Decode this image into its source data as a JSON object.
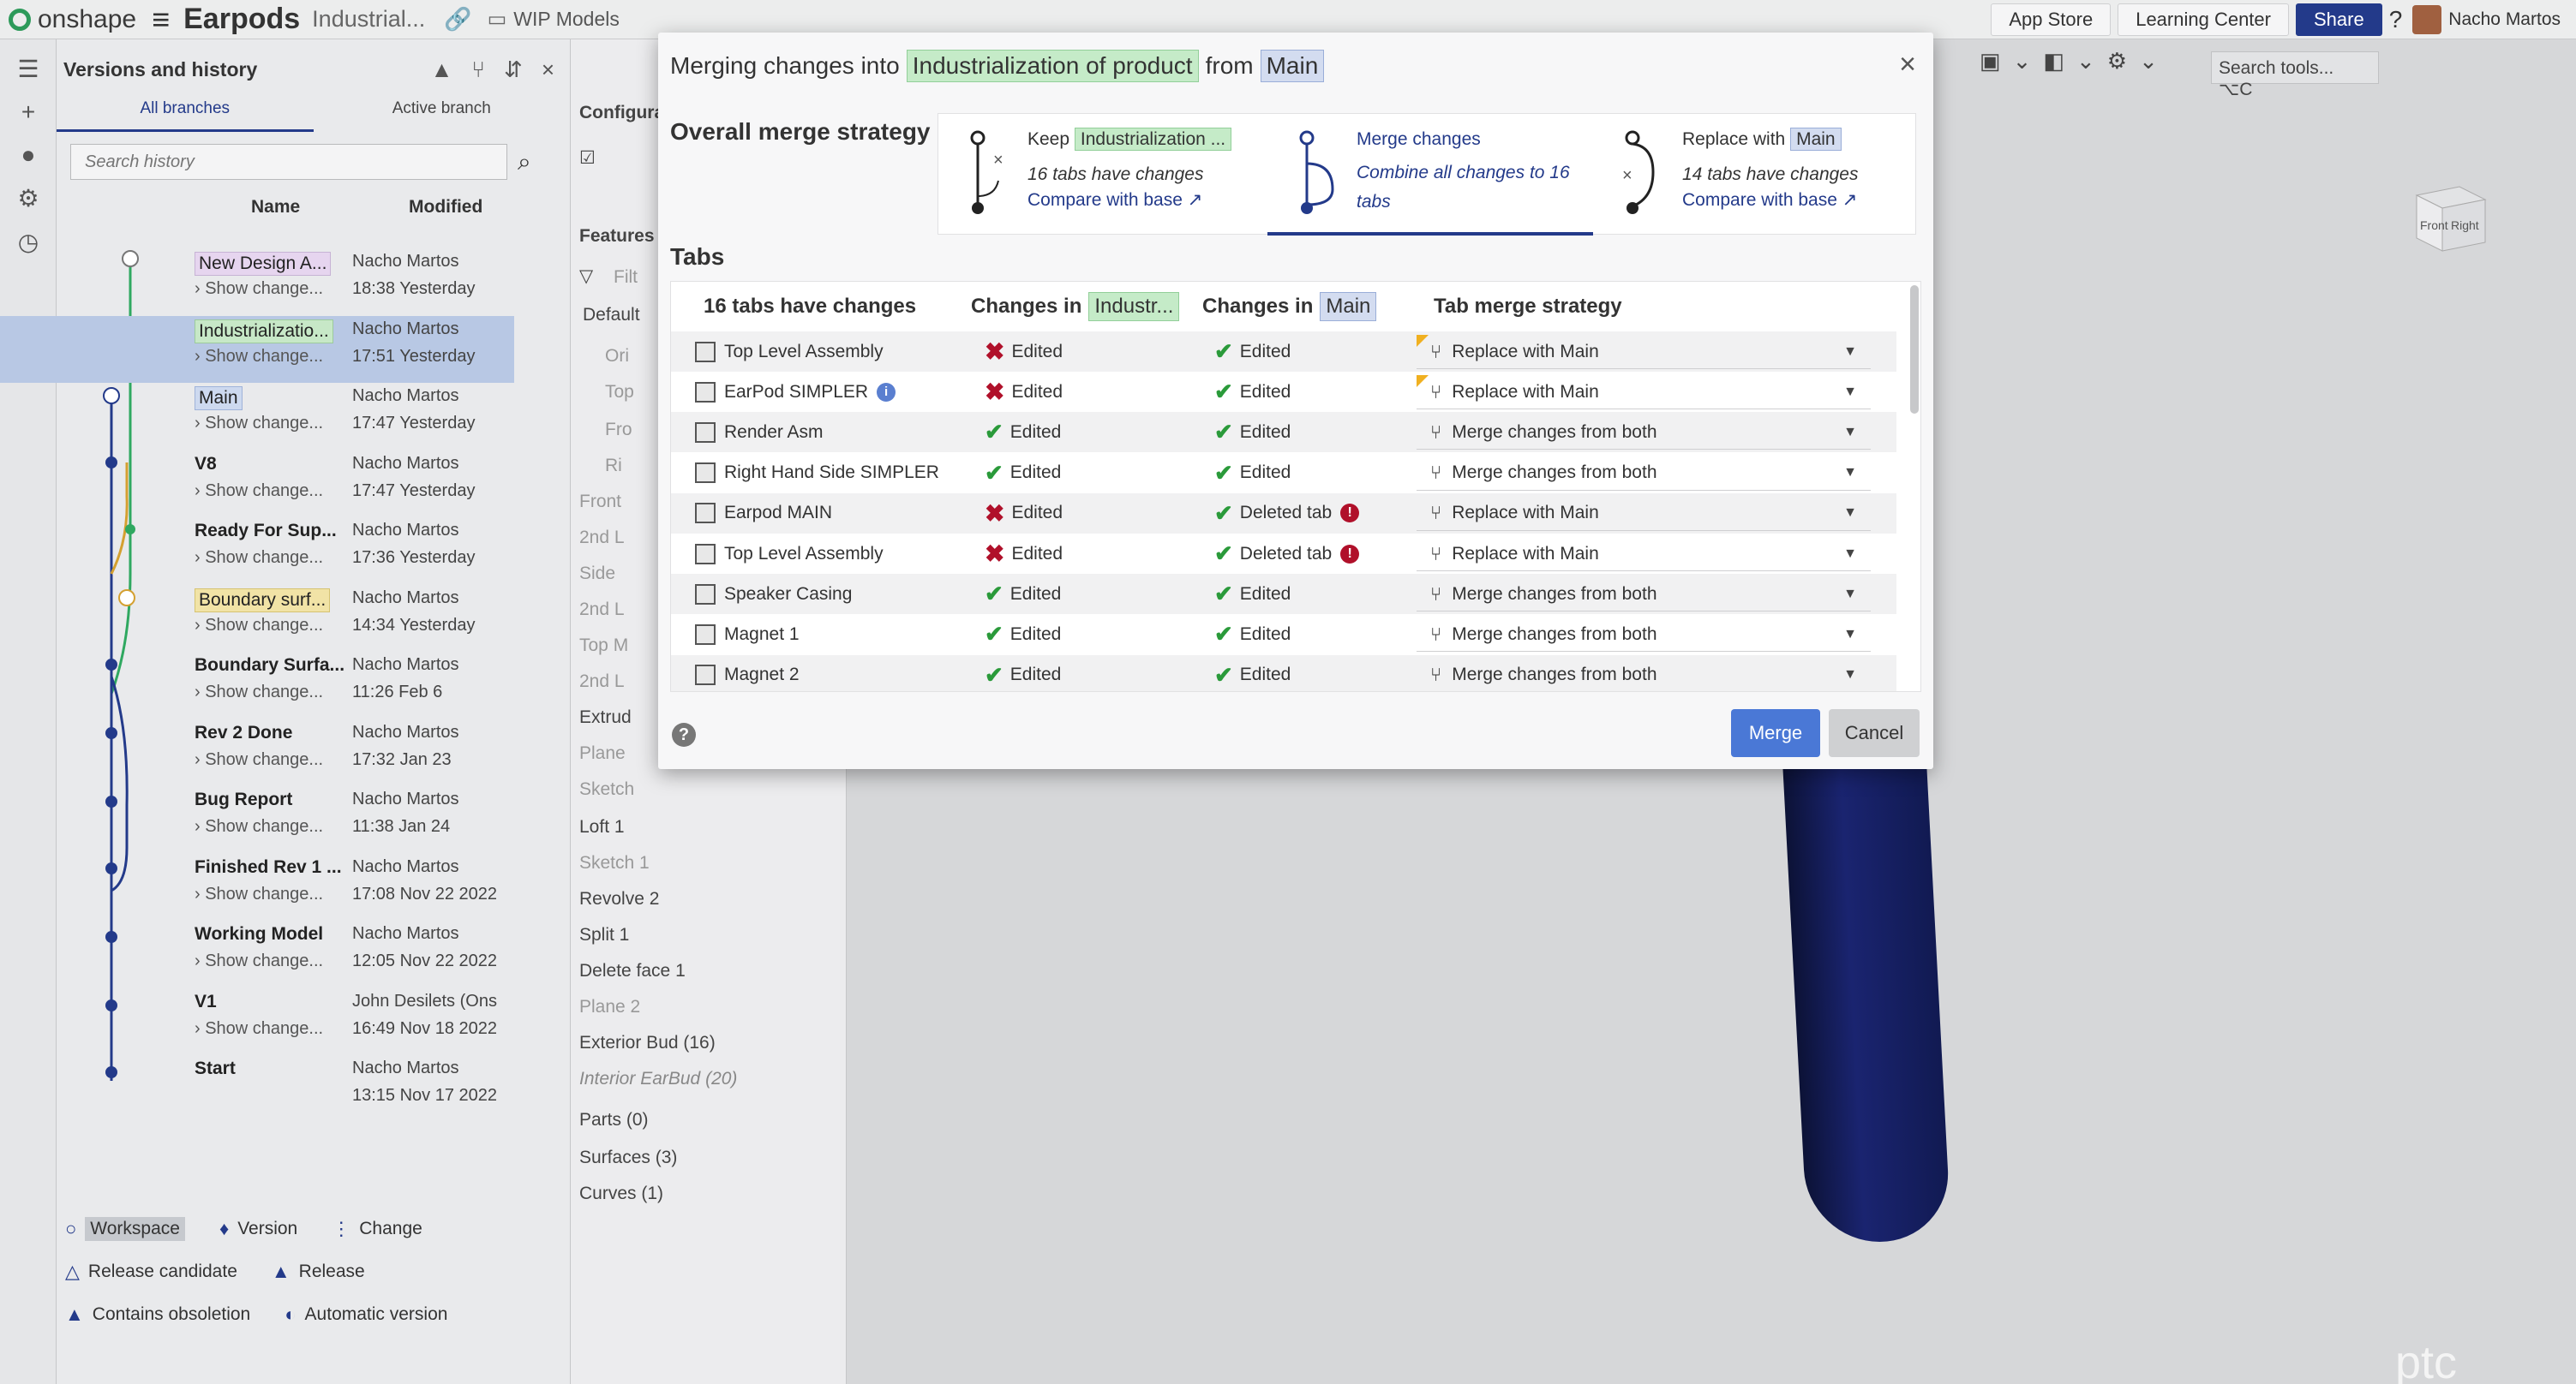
{
  "app": {
    "brand": "onshape",
    "doc_title": "Earpods",
    "doc_subtitle": "Industrial...",
    "folder": "WIP Models",
    "top_buttons": [
      "App Store",
      "Learning Center",
      "Share"
    ],
    "user": "Nacho Martos"
  },
  "versions_panel": {
    "title": "Versions and history",
    "tabs": [
      "All branches",
      "Active branch"
    ],
    "search_placeholder": "Search history",
    "col_name": "Name",
    "col_modified": "Modified",
    "rows": [
      {
        "name": "New Design A...",
        "sub": "Show change...",
        "who": "Nacho Martos",
        "when": "18:38 Yesterday",
        "style": "tag"
      },
      {
        "name": "Industrializatio...",
        "sub": "Show change...",
        "who": "Nacho Martos",
        "when": "17:51 Yesterday",
        "style": "tag green"
      },
      {
        "name": "Main",
        "sub": "Show change...",
        "who": "Nacho Martos",
        "when": "17:47 Yesterday",
        "style": "tag blue"
      },
      {
        "name": "V8",
        "sub": "Show change...",
        "who": "Nacho Martos",
        "when": "17:47 Yesterday",
        "style": ""
      },
      {
        "name": "Ready For Sup...",
        "sub": "Show change...",
        "who": "Nacho Martos",
        "when": "17:36 Yesterday",
        "style": ""
      },
      {
        "name": "Boundary surf...",
        "sub": "Show change...",
        "who": "Nacho Martos",
        "when": "14:34 Yesterday",
        "style": "tag yellow"
      },
      {
        "name": "Boundary Surfa...",
        "sub": "Show change...",
        "who": "Nacho Martos",
        "when": "11:26 Feb 6",
        "style": ""
      },
      {
        "name": "Rev 2 Done",
        "sub": "Show change...",
        "who": "Nacho Martos",
        "when": "17:32 Jan 23",
        "style": ""
      },
      {
        "name": "Bug Report",
        "sub": "Show change...",
        "who": "Nacho Martos",
        "when": "11:38 Jan 24",
        "style": ""
      },
      {
        "name": "Finished Rev 1 ...",
        "sub": "Show change...",
        "who": "Nacho Martos",
        "when": "17:08 Nov 22 2022",
        "style": ""
      },
      {
        "name": "Working Model",
        "sub": "Show change...",
        "who": "Nacho Martos",
        "when": "12:05 Nov 22 2022",
        "style": ""
      },
      {
        "name": "V1",
        "sub": "Show change...",
        "who": "John Desilets (Ons",
        "when": "16:49 Nov 18 2022",
        "style": ""
      },
      {
        "name": "Start",
        "sub": "",
        "who": "Nacho Martos",
        "when": "13:15 Nov 17 2022",
        "style": ""
      }
    ],
    "legend": {
      "workspace": "Workspace",
      "version": "Version",
      "change": "Change",
      "release_candidate": "Release candidate",
      "release": "Release",
      "contains_obsoletion": "Contains obsoletion",
      "automatic_version": "Automatic version"
    }
  },
  "features": {
    "header_config": "Configura",
    "header_features": "Features (",
    "filter_placeholder": "Filt",
    "items": [
      "Default",
      "Ori",
      "Top",
      "Fro",
      "Ri",
      "Front",
      "2nd L",
      "Side",
      "2nd L",
      "Top M",
      "2nd L",
      "Extrud",
      "Plane",
      "Sketch",
      "Loft 1",
      "Sketch 1",
      "Revolve 2",
      "Split 1",
      "Delete face 1",
      "Plane 2",
      "Exterior Bud (16)",
      "Interior EarBud (20)",
      "Parts (0)",
      "Surfaces (3)",
      "Curves (1)"
    ]
  },
  "viewport": {
    "search_tools": "Search tools...",
    "search_shortcut": "⌥C",
    "cube_front": "Front",
    "cube_right": "Right",
    "brand": "ptc"
  },
  "dialog": {
    "title_prefix": "Merging changes into",
    "title_target": "Industrialization of product",
    "title_mid": "from",
    "title_source": "Main",
    "strategy_label": "Overall merge strategy",
    "strategies": [
      {
        "title_prefix": "Keep",
        "title_tag": "Industrialization ...",
        "sub": "16 tabs have changes",
        "compare": "Compare with base ↗"
      },
      {
        "title_prefix": "Merge changes",
        "title_tag": "",
        "sub": "Combine all changes to 16 tabs",
        "compare": ""
      },
      {
        "title_prefix": "Replace with",
        "title_tag": "Main",
        "sub": "14 tabs have changes",
        "compare": "Compare with base ↗"
      }
    ],
    "tabs_label": "Tabs",
    "col_tabs": "16 tabs have changes",
    "col_changes_in": "Changes in",
    "col_target_tag": "Industr...",
    "col_source_tag": "Main",
    "col_strategy": "Tab merge strategy",
    "rows": [
      {
        "name": "Top Level Assembly",
        "info": false,
        "target": "Edited",
        "target_ok": false,
        "source": "Edited",
        "source_warn": false,
        "strategy": "Replace with Main",
        "flag": true
      },
      {
        "name": "EarPod SIMPLER",
        "info": true,
        "target": "Edited",
        "target_ok": false,
        "source": "Edited",
        "source_warn": false,
        "strategy": "Replace with Main",
        "flag": true
      },
      {
        "name": "Render Asm",
        "info": false,
        "target": "Edited",
        "target_ok": true,
        "source": "Edited",
        "source_warn": false,
        "strategy": "Merge changes from both",
        "flag": false
      },
      {
        "name": "Right Hand Side SIMPLER",
        "info": false,
        "target": "Edited",
        "target_ok": true,
        "source": "Edited",
        "source_warn": false,
        "strategy": "Merge changes from both",
        "flag": false
      },
      {
        "name": "Earpod MAIN",
        "info": false,
        "target": "Edited",
        "target_ok": false,
        "source": "Deleted tab",
        "source_warn": true,
        "strategy": "Replace with Main",
        "flag": false
      },
      {
        "name": "Top Level Assembly",
        "info": false,
        "target": "Edited",
        "target_ok": false,
        "source": "Deleted tab",
        "source_warn": true,
        "strategy": "Replace with Main",
        "flag": false
      },
      {
        "name": "Speaker Casing",
        "info": false,
        "target": "Edited",
        "target_ok": true,
        "source": "Edited",
        "source_warn": false,
        "strategy": "Merge changes from both",
        "flag": false
      },
      {
        "name": "Magnet 1",
        "info": false,
        "target": "Edited",
        "target_ok": true,
        "source": "Edited",
        "source_warn": false,
        "strategy": "Merge changes from both",
        "flag": false
      },
      {
        "name": "Magnet 2",
        "info": false,
        "target": "Edited",
        "target_ok": true,
        "source": "Edited",
        "source_warn": false,
        "strategy": "Merge changes from both",
        "flag": false
      }
    ],
    "merge_label": "Merge",
    "cancel_label": "Cancel"
  }
}
